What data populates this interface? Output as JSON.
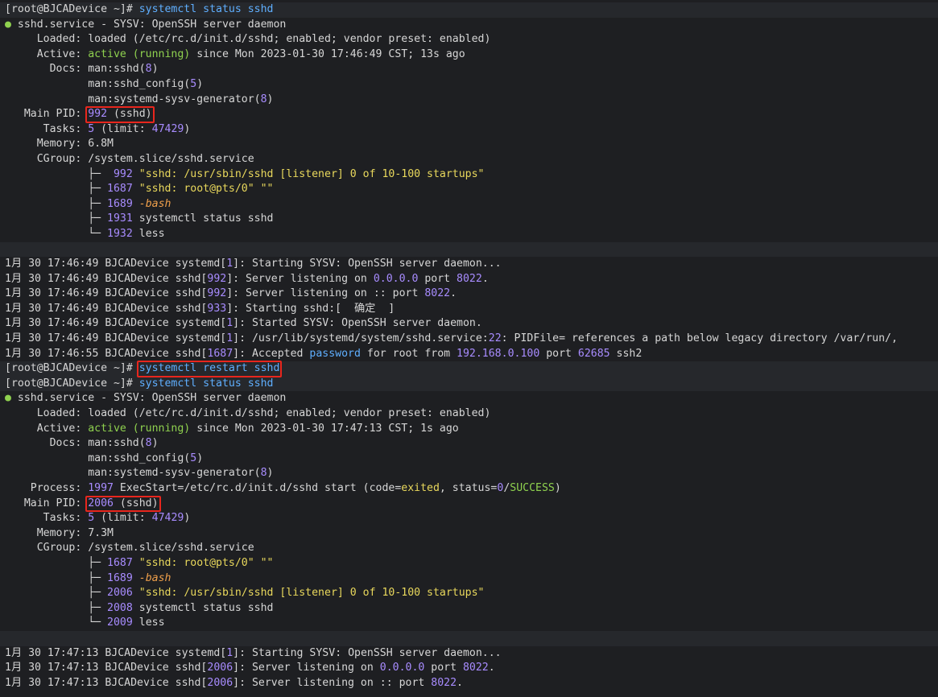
{
  "colors": {
    "background": "#1e1f22",
    "text": "#d6d6d6",
    "command": "#5fafff",
    "number": "#a88cff",
    "active": "#8fd14f",
    "string": "#e9d85c",
    "bash": "#f0a04b",
    "highlight_box": "#e8261d"
  },
  "highlight_boxes": [
    {
      "name": "main-pid-highlight-1",
      "text": "992 (sshd)"
    },
    {
      "name": "restart-command-highlight",
      "text": "systemctl restart sshd"
    },
    {
      "name": "main-pid-highlight-2",
      "text": "2006 (sshd)"
    }
  ],
  "lines": [
    {
      "hl": true,
      "segs": [
        [
          "[root@BJCADevice ~]# ",
          ""
        ],
        [
          "systemctl status sshd",
          "c-blue"
        ]
      ]
    },
    {
      "segs": [
        [
          "● ",
          "c-dot"
        ],
        [
          "sshd.service - SYSV: OpenSSH server daemon",
          ""
        ]
      ]
    },
    {
      "segs": [
        [
          "     Loaded: loaded (/etc/rc.d/init.d/sshd; enabled; vendor preset: enabled)",
          ""
        ]
      ]
    },
    {
      "segs": [
        [
          "     Active: ",
          ""
        ],
        [
          "active (running)",
          "c-grn"
        ],
        [
          " since Mon 2023-01-30 17:46:49 CST; 13s ago",
          ""
        ]
      ]
    },
    {
      "segs": [
        [
          "       Docs: man:sshd(",
          ""
        ],
        [
          "8",
          "c-pur"
        ],
        [
          ")",
          ""
        ]
      ]
    },
    {
      "segs": [
        [
          "             man:sshd_config(",
          ""
        ],
        [
          "5",
          "c-pur"
        ],
        [
          ")",
          ""
        ]
      ]
    },
    {
      "segs": [
        [
          "             man:systemd-sysv-generator(",
          ""
        ],
        [
          "8",
          "c-pur"
        ],
        [
          ")",
          ""
        ]
      ]
    },
    {
      "segs": [
        [
          "   Main PID: ",
          ""
        ],
        [
          "992",
          "c-pur"
        ],
        [
          " (sshd)",
          ""
        ]
      ]
    },
    {
      "segs": [
        [
          "      Tasks: ",
          ""
        ],
        [
          "5",
          "c-pur"
        ],
        [
          " (limit: ",
          ""
        ],
        [
          "47429",
          "c-pur"
        ],
        [
          ")",
          ""
        ]
      ]
    },
    {
      "segs": [
        [
          "     Memory: 6.8M",
          ""
        ]
      ]
    },
    {
      "segs": [
        [
          "     CGroup: /system.slice/sshd.service",
          ""
        ]
      ]
    },
    {
      "segs": [
        [
          "             ├─  ",
          ""
        ],
        [
          "992",
          "c-pur"
        ],
        [
          " \"sshd: /usr/sbin/sshd [listener] 0 of 10-100 startups\"",
          "c-yel"
        ]
      ]
    },
    {
      "segs": [
        [
          "             ├─ ",
          ""
        ],
        [
          "1687",
          "c-pur"
        ],
        [
          " \"sshd: root@pts/0\" \"\"",
          "c-yel"
        ]
      ]
    },
    {
      "segs": [
        [
          "             ├─ ",
          ""
        ],
        [
          "1689",
          "c-pur"
        ],
        [
          " -bash",
          "c-org"
        ]
      ]
    },
    {
      "segs": [
        [
          "             ├─ ",
          ""
        ],
        [
          "1931",
          "c-pur"
        ],
        [
          " systemctl status sshd",
          ""
        ]
      ]
    },
    {
      "segs": [
        [
          "             └─ ",
          ""
        ],
        [
          "1932",
          "c-pur"
        ],
        [
          " less",
          ""
        ]
      ]
    },
    {
      "hl": true,
      "segs": [
        [
          "",
          ""
        ]
      ]
    },
    {
      "segs": [
        [
          "1月 30 17:46:49 BJCADevice systemd[",
          ""
        ],
        [
          "1",
          "c-pur"
        ],
        [
          "]: Starting SYSV: OpenSSH server daemon...",
          ""
        ]
      ]
    },
    {
      "segs": [
        [
          "1月 30 17:46:49 BJCADevice sshd[",
          ""
        ],
        [
          "992",
          "c-pur"
        ],
        [
          "]: Server listening on ",
          ""
        ],
        [
          "0.0.0.0",
          "c-pur"
        ],
        [
          " port ",
          ""
        ],
        [
          "8022",
          "c-pur"
        ],
        [
          ".",
          ""
        ]
      ]
    },
    {
      "segs": [
        [
          "1月 30 17:46:49 BJCADevice sshd[",
          ""
        ],
        [
          "992",
          "c-pur"
        ],
        [
          "]: Server listening on :: port ",
          ""
        ],
        [
          "8022",
          "c-pur"
        ],
        [
          ".",
          ""
        ]
      ]
    },
    {
      "segs": [
        [
          "1月 30 17:46:49 BJCADevice sshd[",
          ""
        ],
        [
          "933",
          "c-pur"
        ],
        [
          "]: Starting sshd:[  确定  ]",
          ""
        ]
      ]
    },
    {
      "segs": [
        [
          "1月 30 17:46:49 BJCADevice systemd[",
          ""
        ],
        [
          "1",
          "c-pur"
        ],
        [
          "]: Started SYSV: OpenSSH server daemon.",
          ""
        ]
      ]
    },
    {
      "segs": [
        [
          "1月 30 17:46:49 BJCADevice systemd[",
          ""
        ],
        [
          "1",
          "c-pur"
        ],
        [
          "]: /usr/lib/systemd/system/sshd.service:",
          ""
        ],
        [
          "22",
          "c-pur"
        ],
        [
          ": PIDFile= references a path below legacy directory /var/run/,",
          ""
        ]
      ]
    },
    {
      "segs": [
        [
          "1月 30 17:46:55 BJCADevice sshd[",
          ""
        ],
        [
          "1687",
          "c-pur"
        ],
        [
          "]: Accepted ",
          ""
        ],
        [
          "password",
          "c-blue"
        ],
        [
          " for root from ",
          ""
        ],
        [
          "192.168.0.100",
          "c-pur"
        ],
        [
          " port ",
          ""
        ],
        [
          "62685",
          "c-pur"
        ],
        [
          " ssh2",
          ""
        ]
      ]
    },
    {
      "hl": true,
      "segs": [
        [
          "[root@BJCADevice ~]# ",
          ""
        ],
        [
          "systemctl restart sshd",
          "c-blue"
        ]
      ]
    },
    {
      "hl": true,
      "segs": [
        [
          "[root@BJCADevice ~]# ",
          ""
        ],
        [
          "systemctl status sshd",
          "c-blue"
        ]
      ]
    },
    {
      "segs": [
        [
          "● ",
          "c-dot"
        ],
        [
          "sshd.service - SYSV: OpenSSH server daemon",
          ""
        ]
      ]
    },
    {
      "segs": [
        [
          "     Loaded: loaded (/etc/rc.d/init.d/sshd; enabled; vendor preset: enabled)",
          ""
        ]
      ]
    },
    {
      "segs": [
        [
          "     Active: ",
          ""
        ],
        [
          "active (running)",
          "c-grn"
        ],
        [
          " since Mon 2023-01-30 17:47:13 CST; 1s ago",
          ""
        ]
      ]
    },
    {
      "segs": [
        [
          "       Docs: man:sshd(",
          ""
        ],
        [
          "8",
          "c-pur"
        ],
        [
          ")",
          ""
        ]
      ]
    },
    {
      "segs": [
        [
          "             man:sshd_config(",
          ""
        ],
        [
          "5",
          "c-pur"
        ],
        [
          ")",
          ""
        ]
      ]
    },
    {
      "segs": [
        [
          "             man:systemd-sysv-generator(",
          ""
        ],
        [
          "8",
          "c-pur"
        ],
        [
          ")",
          ""
        ]
      ]
    },
    {
      "segs": [
        [
          "    Process: ",
          ""
        ],
        [
          "1997",
          "c-pur"
        ],
        [
          " ExecStart=/etc/rc.d/init.d/sshd start (code=",
          ""
        ],
        [
          "exited",
          "c-yel"
        ],
        [
          ", status=",
          ""
        ],
        [
          "0",
          "c-pur"
        ],
        [
          "/",
          ""
        ],
        [
          "SUCCESS",
          "c-grn"
        ],
        [
          ")",
          ""
        ]
      ]
    },
    {
      "segs": [
        [
          "   Main PID: ",
          ""
        ],
        [
          "2006",
          "c-pur"
        ],
        [
          " (sshd)",
          ""
        ]
      ]
    },
    {
      "segs": [
        [
          "      Tasks: ",
          ""
        ],
        [
          "5",
          "c-pur"
        ],
        [
          " (limit: ",
          ""
        ],
        [
          "47429",
          "c-pur"
        ],
        [
          ")",
          ""
        ]
      ]
    },
    {
      "segs": [
        [
          "     Memory: 7.3M",
          ""
        ]
      ]
    },
    {
      "segs": [
        [
          "     CGroup: /system.slice/sshd.service",
          ""
        ]
      ]
    },
    {
      "segs": [
        [
          "             ├─ ",
          ""
        ],
        [
          "1687",
          "c-pur"
        ],
        [
          " \"sshd: root@pts/0\" \"\"",
          "c-yel"
        ]
      ]
    },
    {
      "segs": [
        [
          "             ├─ ",
          ""
        ],
        [
          "1689",
          "c-pur"
        ],
        [
          " -bash",
          "c-org"
        ]
      ]
    },
    {
      "segs": [
        [
          "             ├─ ",
          ""
        ],
        [
          "2006",
          "c-pur"
        ],
        [
          " \"sshd: /usr/sbin/sshd [listener] 0 of 10-100 startups\"",
          "c-yel"
        ]
      ]
    },
    {
      "segs": [
        [
          "             ├─ ",
          ""
        ],
        [
          "2008",
          "c-pur"
        ],
        [
          " systemctl status sshd",
          ""
        ]
      ]
    },
    {
      "segs": [
        [
          "             └─ ",
          ""
        ],
        [
          "2009",
          "c-pur"
        ],
        [
          " less",
          ""
        ]
      ]
    },
    {
      "hl": true,
      "segs": [
        [
          "",
          ""
        ]
      ]
    },
    {
      "segs": [
        [
          "1月 30 17:47:13 BJCADevice systemd[",
          ""
        ],
        [
          "1",
          "c-pur"
        ],
        [
          "]: Starting SYSV: OpenSSH server daemon...",
          ""
        ]
      ]
    },
    {
      "segs": [
        [
          "1月 30 17:47:13 BJCADevice sshd[",
          ""
        ],
        [
          "2006",
          "c-pur"
        ],
        [
          "]: Server listening on ",
          ""
        ],
        [
          "0.0.0.0",
          "c-pur"
        ],
        [
          " port ",
          ""
        ],
        [
          "8022",
          "c-pur"
        ],
        [
          ".",
          ""
        ]
      ]
    },
    {
      "segs": [
        [
          "1月 30 17:47:13 BJCADevice sshd[",
          ""
        ],
        [
          "2006",
          "c-pur"
        ],
        [
          "]: Server listening on :: port ",
          ""
        ],
        [
          "8022",
          "c-pur"
        ],
        [
          ".",
          ""
        ]
      ]
    }
  ]
}
